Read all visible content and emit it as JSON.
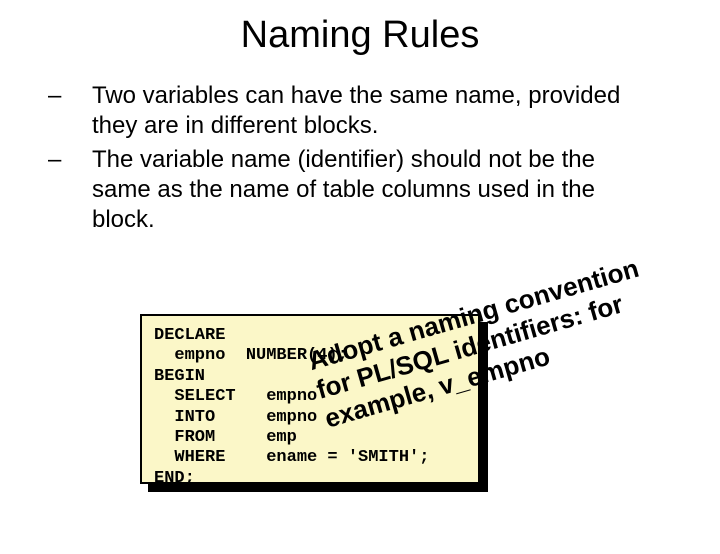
{
  "title": "Naming Rules",
  "bullets": [
    "Two variables can have the same name, provided they are in different blocks.",
    "The variable name (identifier) should not be the same as the name of table columns used in the block."
  ],
  "code": "DECLARE\n  empno  NUMBER(4);\nBEGIN\n  SELECT   empno\n  INTO     empno\n  FROM     emp\n  WHERE    ename = 'SMITH';\nEND;",
  "overlay": "Adopt a naming convention for PL/SQL identifiers: for example, v_empno"
}
